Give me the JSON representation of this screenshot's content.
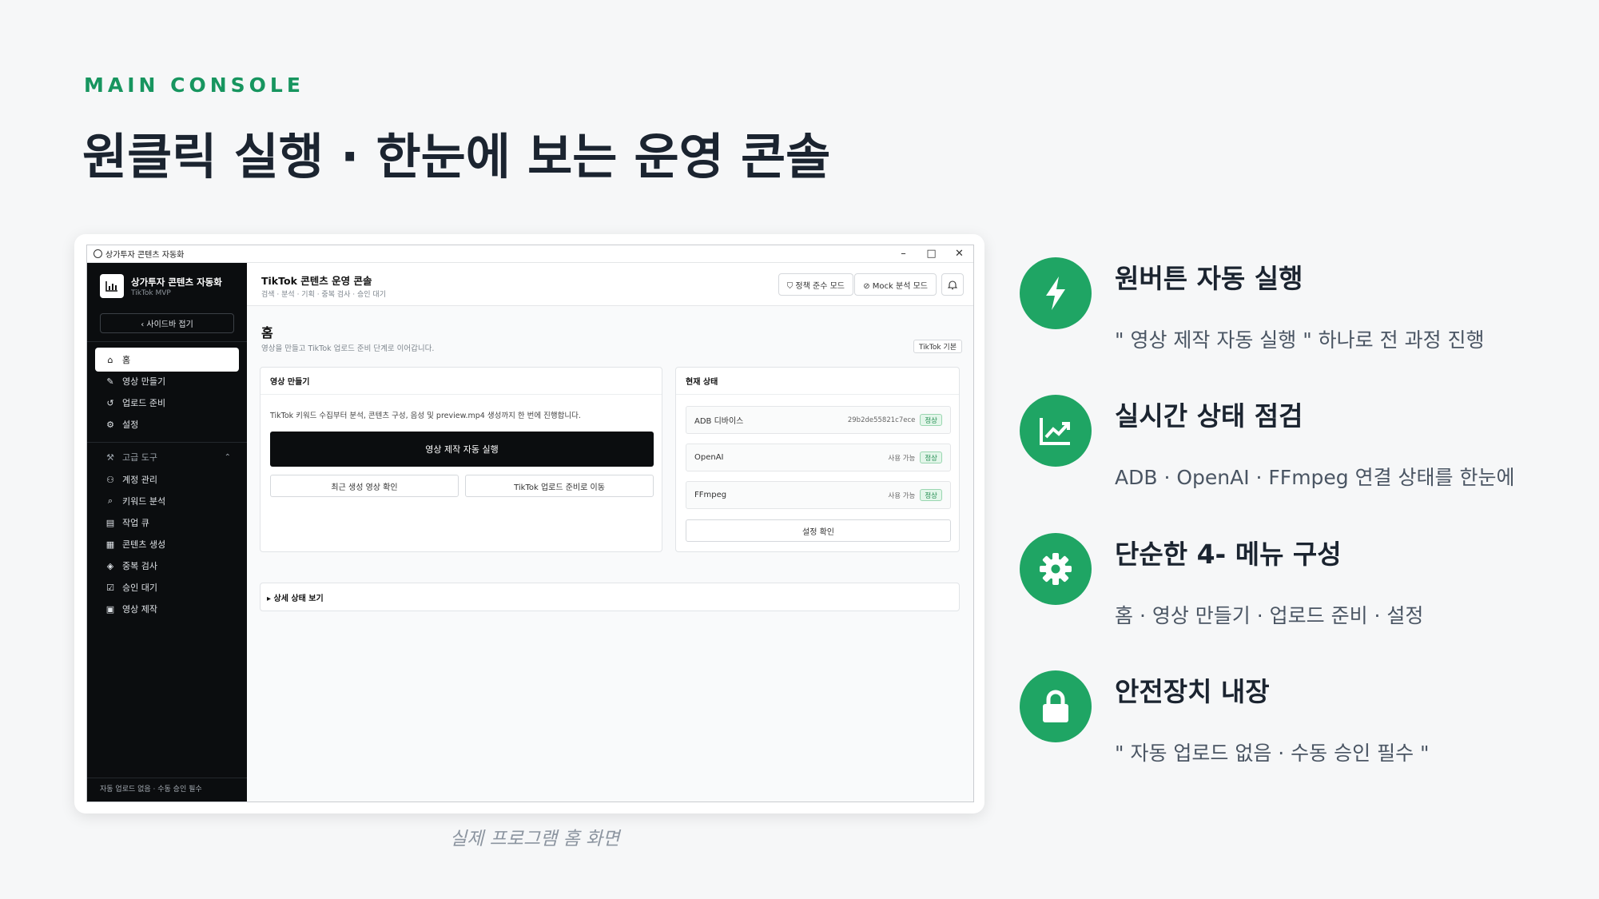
{
  "slide": {
    "eyebrow": "MAIN CONSOLE",
    "headline": "원클릭 실행 · 한눈에 보는 운영 콘솔",
    "caption": "실제 프로그램 홈 화면"
  },
  "app": {
    "window_title": "상가투자 콘텐츠 자동화",
    "window_controls": [
      "–",
      "□",
      "✕"
    ],
    "sidebar": {
      "brand_title": "상가투자 콘텐츠 자동화",
      "brand_subtitle": "TikTok MVP",
      "collapse_label": "‹  사이드바 접기",
      "main_items": [
        {
          "label": "홈",
          "icon": "home-icon",
          "glyph": "⌂",
          "active": true
        },
        {
          "label": "영상 만들기",
          "icon": "magic-wand-icon",
          "glyph": "✎"
        },
        {
          "label": "업로드 준비",
          "icon": "history-icon",
          "glyph": "↺"
        },
        {
          "label": "설정",
          "icon": "gear-icon",
          "glyph": "⚙"
        }
      ],
      "group_label": "고급 도구",
      "group_icon_glyph": "⚒",
      "group_caret": "⌃",
      "advanced_items": [
        {
          "label": "계정 관리",
          "icon": "users-icon",
          "glyph": "⚇"
        },
        {
          "label": "키워드 분석",
          "icon": "search-icon",
          "glyph": "⌕"
        },
        {
          "label": "작업 큐",
          "icon": "clipboard-icon",
          "glyph": "▤"
        },
        {
          "label": "콘텐츠 생성",
          "icon": "document-icon",
          "glyph": "▦"
        },
        {
          "label": "중복 검사",
          "icon": "layers-icon",
          "glyph": "◈"
        },
        {
          "label": "승인 대기",
          "icon": "check-square-icon",
          "glyph": "☑"
        },
        {
          "label": "영상 제작",
          "icon": "film-icon",
          "glyph": "▣"
        }
      ],
      "footer": "자동 업로드 없음 · 수동 승인 필수"
    },
    "topbar": {
      "title": "TikTok 콘텐츠 운영 콘솔",
      "subtitle": "검색 · 분석 · 기획 · 중복 검사 · 승인 대기",
      "policy_button": "⛉  정책 준수 모드",
      "mock_button": "⊘  Mock 분석 모드",
      "bell_glyph": "🔔"
    },
    "page": {
      "title": "홈",
      "subtitle": "영상을 만들고 TikTok 업로드 준비 단계로 이어갑니다.",
      "badge": "TikTok 기본"
    },
    "make_panel": {
      "title": "영상 만들기",
      "description": "TikTok 키워드 수집부터 분석, 콘텐츠 구성, 음성 및 preview.mp4 생성까지 한 번에 진행합니다.",
      "run_button": "영상 제작 자동 실행",
      "recent_button": "최근 생성 영상 확인",
      "upload_button": "TikTok 업로드 준비로 이동"
    },
    "status_panel": {
      "title": "현재 상태",
      "rows": [
        {
          "name": "ADB 디바이스",
          "meta": "29b2de55821c7ece",
          "state": "정상"
        },
        {
          "name": "OpenAI",
          "meta": "사용 가능",
          "state": "정상"
        },
        {
          "name": "FFmpeg",
          "meta": "사용 가능",
          "state": "정상"
        }
      ],
      "check_button": "설정 확인"
    },
    "details_toggle": "▸ 상세 상태 보기"
  },
  "features": [
    {
      "title": "원버튼 자동 실행",
      "desc": "\" 영상 제작 자동 실행 \"  하나로 전 과정 진행",
      "icon": "lightning-icon"
    },
    {
      "title": "실시간 상태 점검",
      "desc": "ADB · OpenAI · FFmpeg  연결 상태를 한눈에",
      "icon": "trend-chart-icon"
    },
    {
      "title": "단순한  4- 메뉴 구성",
      "desc": "홈  ·  영상 만들기  ·  업로드 준비  ·  설정",
      "icon": "gear-icon"
    },
    {
      "title": "안전장치 내장",
      "desc": "\" 자동 업로드 없음  ·  수동 승인 필수 \"",
      "icon": "lock-icon"
    }
  ],
  "colors": {
    "accent": "#1fa564",
    "eyebrow": "#17955f",
    "sidebar_bg": "#0b0d0f",
    "ok_badge": "#1e8a4d"
  }
}
